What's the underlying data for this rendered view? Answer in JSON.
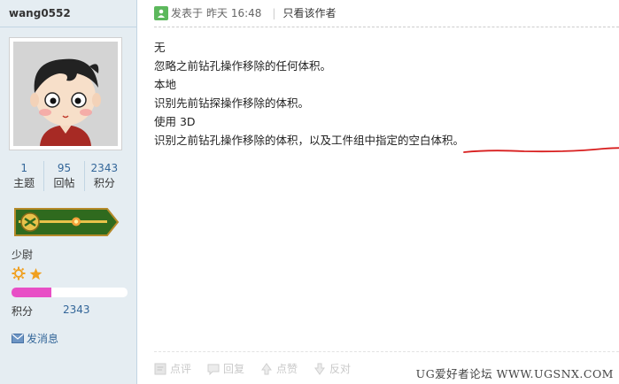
{
  "user": {
    "username": "wang0552",
    "stats": [
      {
        "value": "1",
        "label": "主题"
      },
      {
        "value": "95",
        "label": "回帖"
      },
      {
        "value": "2343",
        "label": "积分"
      }
    ],
    "rank_title": "少尉",
    "rank_progress_percent": 34,
    "credits_label": "积分",
    "credits_value": "2343",
    "send_message_label": "发消息"
  },
  "post": {
    "posted_prefix": "发表于",
    "posted_time": "昨天 16:48",
    "only_author_label": "只看该作者",
    "lines": [
      "无",
      "忽略之前钻孔操作移除的任何体积。",
      "本地",
      "识别先前钻探操作移除的体积。",
      "使用 3D",
      "识别之前钻孔操作移除的体积，以及工件组中指定的空白体积。"
    ],
    "underline_color": "#d81e1e"
  },
  "actions": [
    {
      "label": "点评",
      "icon": "comment-icon"
    },
    {
      "label": "回复",
      "icon": "reply-icon"
    },
    {
      "label": "点赞",
      "icon": "thumbs-up-icon"
    },
    {
      "label": "反对",
      "icon": "thumbs-down-icon"
    }
  ],
  "watermark": "UG爱好者论坛 WWW.UGSNX.COM"
}
